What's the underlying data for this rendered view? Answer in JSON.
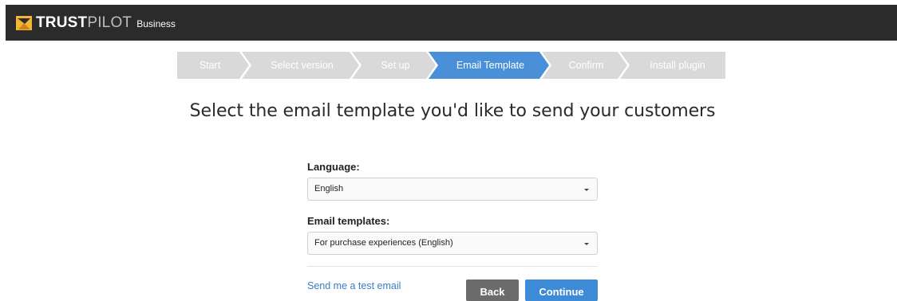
{
  "brand": {
    "name_bold": "TRUST",
    "name_light": "PILOT",
    "suffix": "Business",
    "logo_color": "#f2b632"
  },
  "wizard": {
    "active_color": "#4a90d9",
    "inactive_color": "#d9d9d9",
    "steps": [
      {
        "label": "Start",
        "active": false
      },
      {
        "label": "Select version",
        "active": false
      },
      {
        "label": "Set up",
        "active": false
      },
      {
        "label": "Email Template",
        "active": true
      },
      {
        "label": "Confirm",
        "active": false
      },
      {
        "label": "Install plugin",
        "active": false
      }
    ]
  },
  "page": {
    "heading": "Select the email template you'd like to send your customers"
  },
  "form": {
    "language_label": "Language:",
    "language_value": "English",
    "templates_label": "Email templates:",
    "templates_value": "For purchase experiences (English)",
    "test_email_link": "Send me a test email",
    "back_label": "Back",
    "continue_label": "Continue"
  }
}
